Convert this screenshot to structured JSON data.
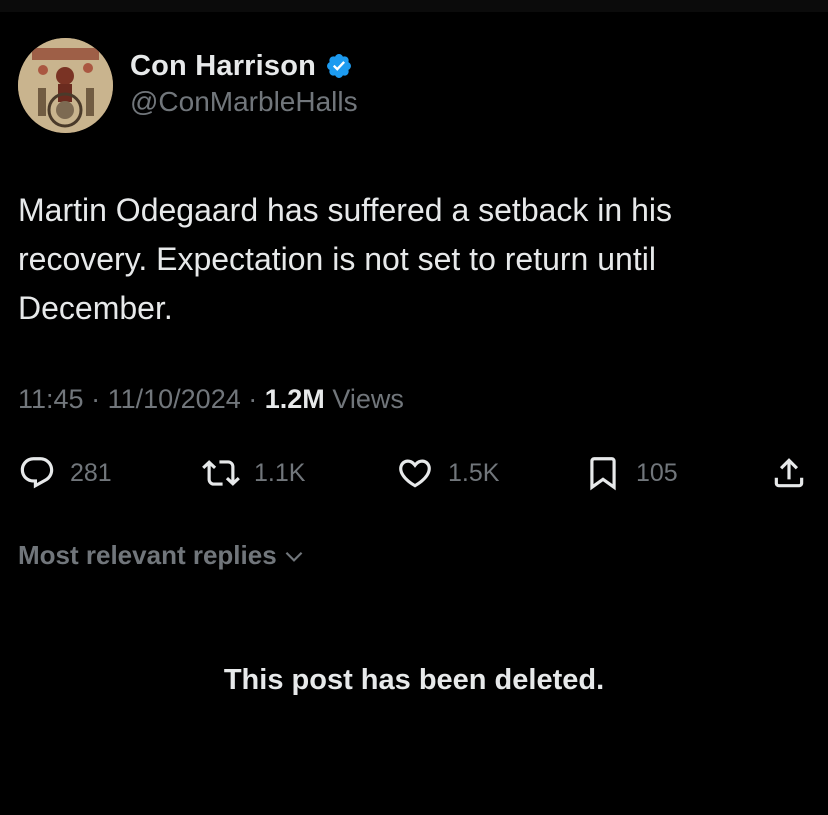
{
  "colors": {
    "background": "#000000",
    "text_primary": "#e7e9ea",
    "text_secondary": "#71767b",
    "verified_badge": "#1d9bf0"
  },
  "author": {
    "display_name": "Con Harrison",
    "handle": "@ConMarbleHalls",
    "verified": true,
    "avatar_icon": "illustrated-avatar",
    "badge_icon": "verified-badge-icon"
  },
  "post": {
    "text": "Martin Odegaard has suffered a setback in his recovery. Expectation is not set to return until December.",
    "time": "11:45",
    "date": "11/10/2024",
    "separator": "·",
    "views_count": "1.2M",
    "views_label": "Views"
  },
  "actions": {
    "reply": {
      "icon": "reply-icon",
      "count": "281"
    },
    "repost": {
      "icon": "repost-icon",
      "count": "1.1K"
    },
    "like": {
      "icon": "heart-icon",
      "count": "1.5K"
    },
    "bookmark": {
      "icon": "bookmark-icon",
      "count": "105"
    },
    "share": {
      "icon": "share-icon"
    }
  },
  "replies": {
    "sort_label": "Most relevant replies",
    "sort_icon": "chevron-down-icon",
    "deleted_notice": "This post has been deleted."
  }
}
